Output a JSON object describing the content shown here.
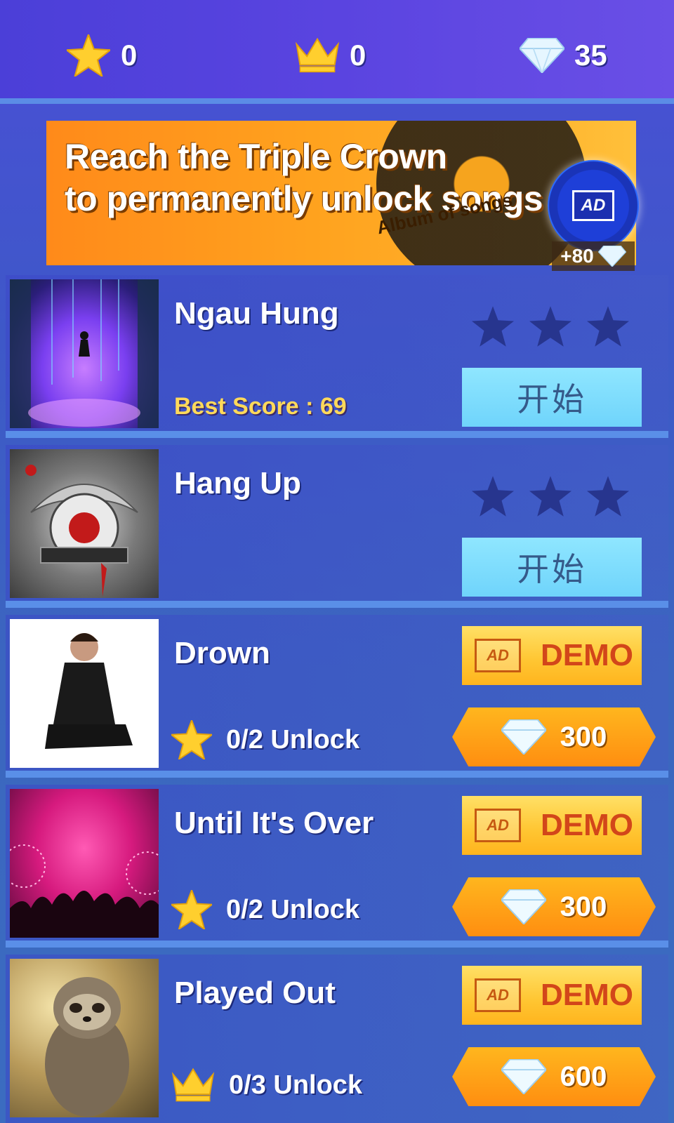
{
  "stats": {
    "stars": "0",
    "crowns": "0",
    "gems": "35"
  },
  "banner": {
    "line1": "Reach the Triple Crown",
    "line2": "to permanently unlock songs",
    "album_text": "Album of songs",
    "ad_label": "AD",
    "ad_reward": "+80"
  },
  "colors": {
    "accent_blue": "#5a8fe8",
    "start_button": "#7fdcfd",
    "demo_button": "#ffc531",
    "gem_button": "#ffa018",
    "gold": "#ffd95a"
  },
  "songs": [
    {
      "title": "Ngau Hung",
      "best_score": "Best Score : 69",
      "stars_earned": 0,
      "start_label": "开始"
    },
    {
      "title": "Hang Up",
      "stars_earned": 0,
      "start_label": "开始"
    },
    {
      "title": "Drown",
      "demo_ad": "AD",
      "demo_label": "DEMO",
      "gem_price": "300",
      "unlock_text": "0/2 Unlock",
      "unlock_icon": "star-icon"
    },
    {
      "title": "Until It's Over",
      "demo_ad": "AD",
      "demo_label": "DEMO",
      "gem_price": "300",
      "unlock_text": "0/2 Unlock",
      "unlock_icon": "star-icon"
    },
    {
      "title": "Played Out",
      "demo_ad": "AD",
      "demo_label": "DEMO",
      "gem_price": "600",
      "unlock_text": "0/3 Unlock",
      "unlock_icon": "crown-icon"
    }
  ]
}
